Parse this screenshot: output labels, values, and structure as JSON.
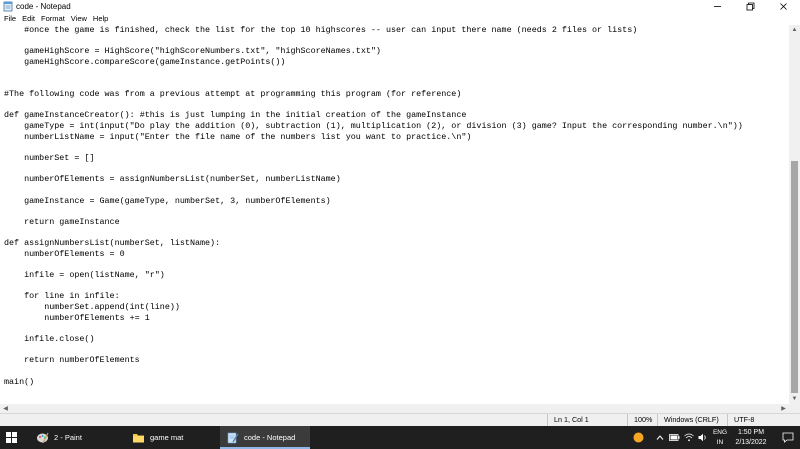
{
  "window": {
    "title": "code - Notepad",
    "minimize_glyph": "—",
    "maximize_glyph": "❐",
    "close_glyph": "✕"
  },
  "menu": [
    "File",
    "Edit",
    "Format",
    "View",
    "Help"
  ],
  "editor": {
    "lines": [
      "    #once the game is finished, check the list for the top 10 highscores -- user can input there name (needs 2 files or lists)",
      "",
      "    gameHighScore = HighScore(\"highScoreNumbers.txt\", \"highScoreNames.txt\")",
      "    gameHighScore.compareScore(gameInstance.getPoints())",
      "",
      "",
      "#The following code was from a previous attempt at programming this program (for reference)",
      "",
      "def gameInstanceCreator(): #this is just lumping in the initial creation of the gameInstance",
      "    gameType = int(input(\"Do play the addition (0), subtraction (1), multiplication (2), or division (3) game? Input the corresponding number.\\n\"))",
      "    numberListName = input(\"Enter the file name of the numbers list you want to practice.\\n\")",
      "",
      "    numberSet = []",
      "",
      "    numberOfElements = assignNumbersList(numberSet, numberListName)",
      "",
      "    gameInstance = Game(gameType, numberSet, 3, numberOfElements)",
      "",
      "    return gameInstance",
      "",
      "def assignNumbersList(numberSet, listName):",
      "    numberOfElements = 0",
      "",
      "    infile = open(listName, \"r\")",
      "",
      "    for line in infile:",
      "        numberSet.append(int(line))",
      "        numberOfElements += 1",
      "",
      "    infile.close()",
      "",
      "    return numberOfElements",
      "",
      "main()"
    ]
  },
  "statusbar": {
    "position": "Ln 1, Col 1",
    "zoom": "100%",
    "line_ending": "Windows (CRLF)",
    "encoding": "UTF-8"
  },
  "taskbar": {
    "items": [
      {
        "label": "2 - Paint",
        "icon": "paint-icon"
      },
      {
        "label": "game mat",
        "icon": "folder-icon"
      },
      {
        "label": "code - Notepad",
        "icon": "notepad-icon"
      }
    ],
    "language_top": "ENG",
    "language_bottom": "IN",
    "time": "1:50 PM",
    "date": "2/13/2022"
  },
  "colors": {
    "taskbar_bg": "#1f1f1f",
    "active_task_underline": "#8fb8e8",
    "scrollbar_thumb": "#a6a6a6",
    "statusbar_bg": "#f0f0f0"
  }
}
